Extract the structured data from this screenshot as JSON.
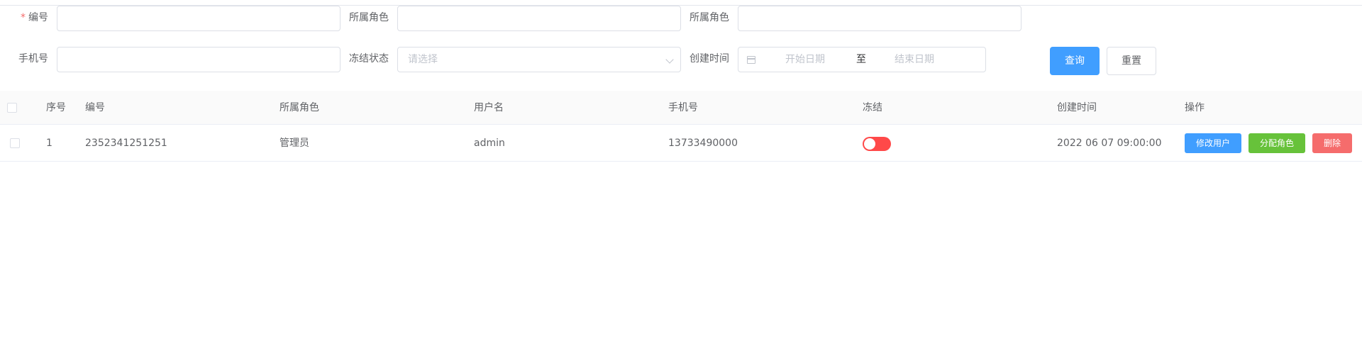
{
  "colors": {
    "primary": "#409eff",
    "success": "#67c23a",
    "danger": "#f56c6c",
    "switch_off": "#ff4949",
    "required": "#f56c6c"
  },
  "form": {
    "required_mark": "*",
    "row1": {
      "id_label": "编号",
      "id_value": "",
      "role_label_1": "所属角色",
      "role_value_1": "",
      "role_label_2": "所属角色",
      "role_value_2": ""
    },
    "row2": {
      "phone_label": "手机号",
      "phone_value": "",
      "freeze_label": "冻结状态",
      "freeze_placeholder": "请选择",
      "created_label": "创建时间",
      "start_placeholder": "开始日期",
      "range_separator": "至",
      "end_placeholder": "结束日期"
    },
    "query_button": "查询",
    "reset_button": "重置"
  },
  "table": {
    "columns": [
      "序号",
      "编号",
      "所属角色",
      "用户名",
      "手机号",
      "冻结",
      "创建时间",
      "操作"
    ],
    "rows": [
      {
        "index": "1",
        "id": "2352341251251",
        "role": "管理员",
        "username": "admin",
        "phone": "13733490000",
        "frozen": false,
        "created": "2022 06 07 09:00:00",
        "actions": {
          "edit": "修改用户",
          "assign": "分配角色",
          "delete": "删除"
        }
      }
    ]
  }
}
